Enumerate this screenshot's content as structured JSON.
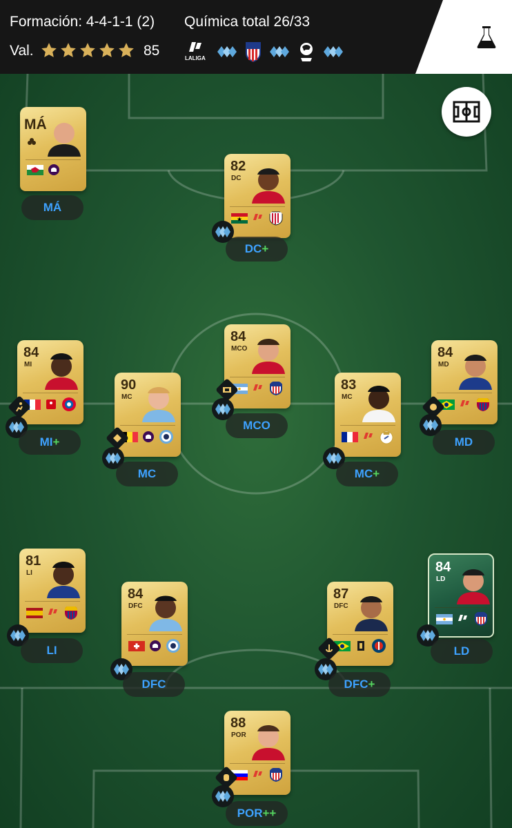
{
  "header": {
    "formation_label": "Formación: 4-4-1-1 (2)",
    "chemistry_label": "Química total 26/33",
    "rating_label": "Val.",
    "rating_value": "85",
    "stars": 5,
    "chem_sources": [
      "LALIGA",
      "diamond",
      "atletico-crest",
      "diamond",
      "premier-league-lion",
      "diamond"
    ],
    "league_text": "LALIGA"
  },
  "colors": {
    "header_bg": "#161616",
    "pitch_green": "#1f5530",
    "card_gold": "#e3bf5c",
    "pill_blue": "#3ea2ff",
    "plus_green": "#55d45f"
  },
  "manager": {
    "label": "MÁ",
    "pill": "MÁ",
    "flags": [
      "wales",
      "premier-league"
    ]
  },
  "players": [
    {
      "id": "st",
      "rating": "82",
      "pos": "DC",
      "pill": "DC",
      "plus": "+",
      "flags": [
        "ghana",
        "laliga",
        "athletic-bilbao"
      ]
    },
    {
      "id": "lm",
      "rating": "84",
      "pos": "MI",
      "pill": "MI",
      "plus": "+",
      "flags": [
        "france",
        "bundesliga",
        "bayern"
      ]
    },
    {
      "id": "cam",
      "rating": "84",
      "pos": "MCO",
      "pill": "MCO",
      "plus": "",
      "flags": [
        "argentina",
        "laliga",
        "atletico"
      ]
    },
    {
      "id": "rm",
      "rating": "84",
      "pos": "MD",
      "pill": "MD",
      "plus": "",
      "flags": [
        "brazil",
        "laliga",
        "barcelona"
      ]
    },
    {
      "id": "lcm",
      "rating": "90",
      "pos": "MC",
      "pill": "MC",
      "plus": "",
      "flags": [
        "belgium",
        "premier-league",
        "man-city"
      ]
    },
    {
      "id": "rcm",
      "rating": "83",
      "pos": "MC",
      "pill": "MC",
      "plus": "+",
      "flags": [
        "france",
        "laliga",
        "real-madrid"
      ]
    },
    {
      "id": "lb",
      "rating": "81",
      "pos": "LI",
      "pill": "LI",
      "plus": "",
      "flags": [
        "spain",
        "laliga",
        "barcelona"
      ]
    },
    {
      "id": "rb",
      "rating": "84",
      "pos": "LD",
      "pill": "LD",
      "plus": "",
      "flags": [
        "argentina",
        "laliga",
        "atletico"
      ]
    },
    {
      "id": "lcb",
      "rating": "84",
      "pos": "DFC",
      "pill": "DFC",
      "plus": "",
      "flags": [
        "switzerland",
        "premier-league",
        "man-city"
      ]
    },
    {
      "id": "rcb",
      "rating": "87",
      "pos": "DFC",
      "pill": "DFC",
      "plus": "+",
      "flags": [
        "brazil",
        "ligue1",
        "psg"
      ]
    },
    {
      "id": "gk",
      "rating": "88",
      "pos": "POR",
      "pill": "POR",
      "plus": "++",
      "flags": [
        "slovenia",
        "laliga",
        "atletico"
      ]
    }
  ]
}
